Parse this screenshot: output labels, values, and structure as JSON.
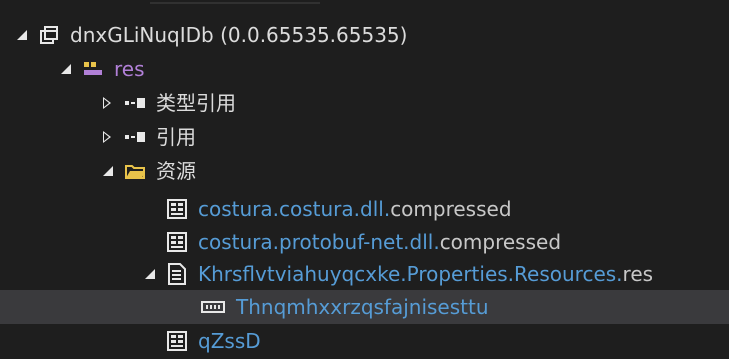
{
  "tree": {
    "assembly": {
      "label": "dnxGLiNuqIDb (0.0.65535.65535)",
      "icon": "assembly-icon"
    },
    "module": {
      "label": "res",
      "icon": "module-icon"
    },
    "type_references": {
      "label": "类型引用",
      "icon": "reference-icon"
    },
    "references": {
      "label": "引用",
      "icon": "reference-icon"
    },
    "resources_folder": {
      "label": "资源",
      "icon": "folder-icon"
    },
    "resource_1": {
      "name": "costura.costura.dll.",
      "suffix": "compressed",
      "icon": "resource-file-icon"
    },
    "resource_2": {
      "name": "costura.protobuf-net.dll.",
      "suffix": "compressed",
      "icon": "resource-file-icon"
    },
    "resource_set": {
      "name": "Khrsflvtviahuyqcxke.Properties.Resources.",
      "suffix": "res",
      "icon": "resource-set-icon"
    },
    "resource_entry": {
      "label": "Thnqmhxxrzqsfajnisesttu",
      "icon": "binary-data-icon"
    },
    "resource_3": {
      "label": "qZssD",
      "icon": "resource-file-icon"
    }
  },
  "colors": {
    "background": "#1e1e1e",
    "selection": "#3a3a3d",
    "text": "#dcdcdc",
    "module": "#b180d7",
    "resource": "#569cd6",
    "folder": "#e8c34a"
  }
}
